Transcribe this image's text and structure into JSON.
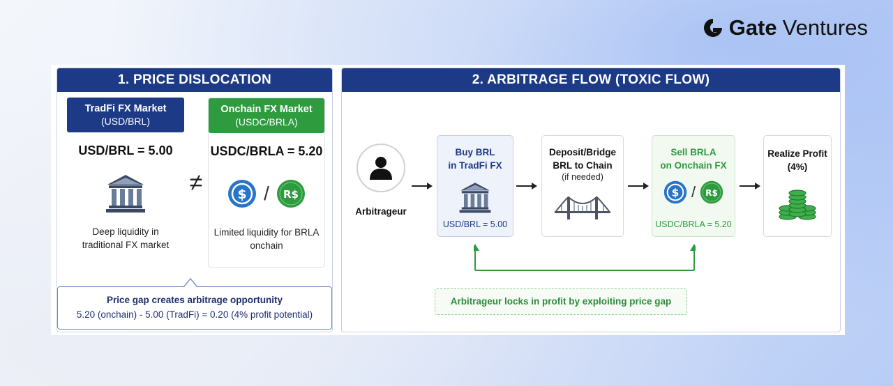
{
  "brand": {
    "bold": "Gate",
    "light": "Ventures"
  },
  "panel1": {
    "title": "1. PRICE DISLOCATION",
    "left": {
      "title": "TradFi FX Market",
      "subtitle": "(USD/BRL)",
      "rate": "USD/BRL = 5.00",
      "desc_line1": "Deep liquidity in",
      "desc_line2": "traditional FX market"
    },
    "neq": "≠",
    "right": {
      "title": "Onchain FX Market",
      "subtitle": "(USDC/BRLA)",
      "rate": "USDC/BRLA = 5.20",
      "slash": "/",
      "desc_line1": "Limited liquidity for BRLA",
      "desc_line2": "onchain"
    },
    "callout": {
      "line1": "Price gap creates arbitrage opportunity",
      "line2": "5.20 (onchain) - 5.00 (TradFi) = 0.20 (4% profit potential)"
    }
  },
  "panel2": {
    "title": "2. ARBITRAGE FLOW (TOXIC FLOW)",
    "actor": "Arbitrageur",
    "step1": {
      "line1": "Buy BRL",
      "line2": "in TradFi FX",
      "foot": "USD/BRL = 5.00"
    },
    "step2": {
      "line1": "Deposit/Bridge",
      "line2": "BRL to Chain",
      "line3": "(if needed)"
    },
    "step3": {
      "line1": "Sell BRLA",
      "line2": "on Onchain FX",
      "slash": "/",
      "foot": "USDC/BRLA = 5.20"
    },
    "step4": {
      "line1": "Realize Profit",
      "line2": "(4%)"
    },
    "note": "Arbitrageur locks in profit by exploiting price gap"
  },
  "colors": {
    "navy": "#1c3a85",
    "green": "#2e9b3f",
    "usdc_blue": "#2775ca"
  },
  "icons": [
    "gate-logo-icon",
    "bank-icon",
    "usdc-coin-icon",
    "brl-coin-icon",
    "user-icon",
    "bridge-icon",
    "coin-stack-icon",
    "arrow-right-icon"
  ]
}
